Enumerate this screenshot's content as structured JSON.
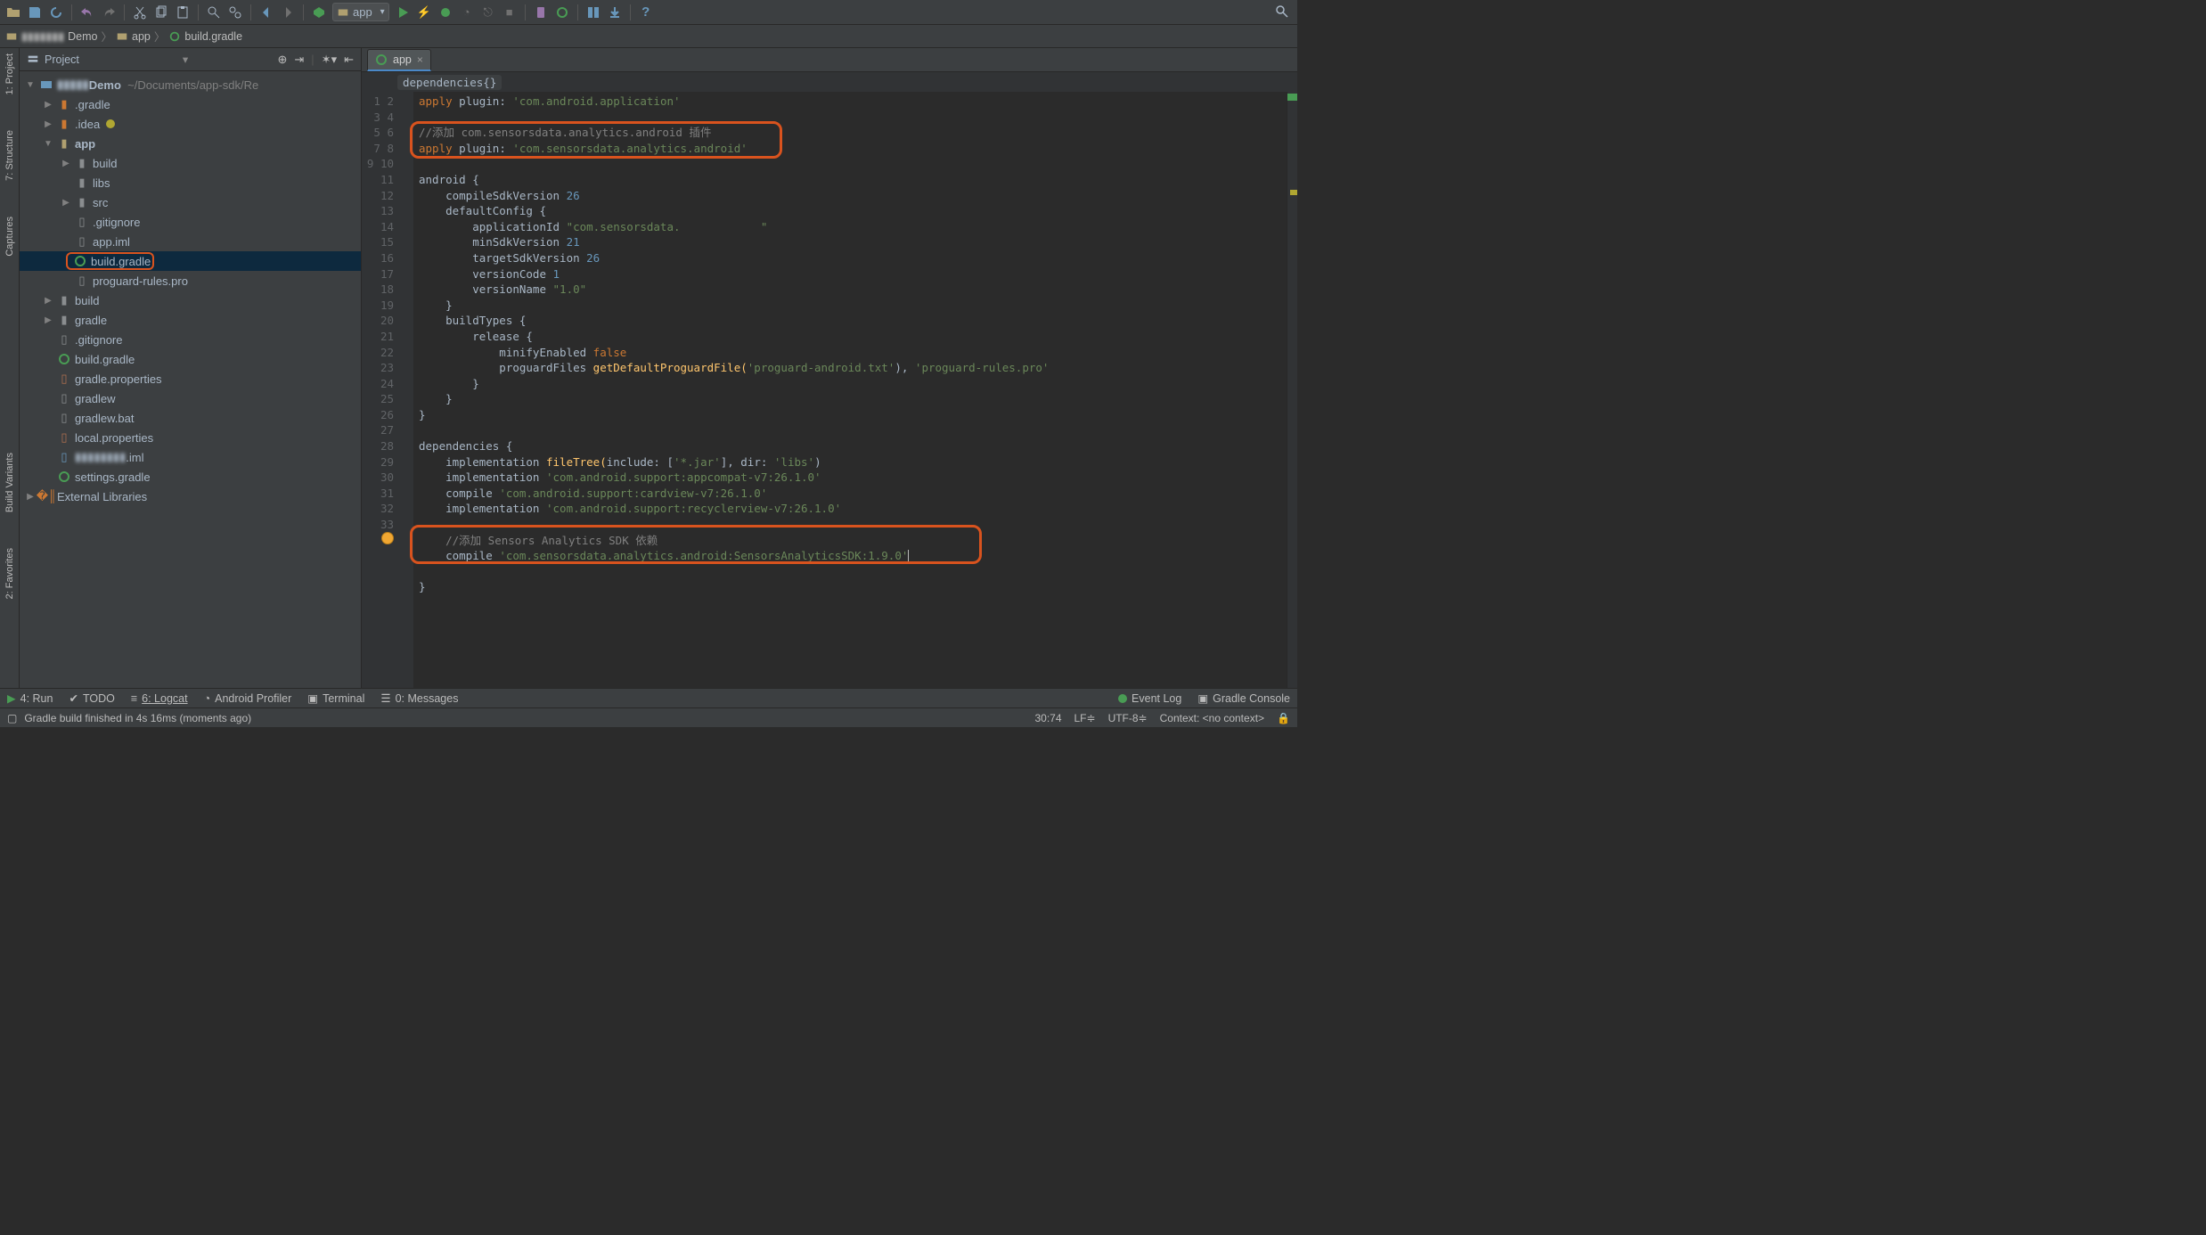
{
  "toolbar": {
    "run_config": "app"
  },
  "breadcrumb": {
    "c1": "Demo",
    "c2": "app",
    "c3": "build.gradle"
  },
  "side": {
    "project": "1: Project",
    "structure": "7: Structure",
    "captures": "Captures",
    "buildvariants": "Build Variants",
    "favorites": "2: Favorites"
  },
  "panel": {
    "title": "Project"
  },
  "tree": {
    "root": "Demo",
    "root_path": "~/Documents/app-sdk/Re",
    "gradle_dir": ".gradle",
    "idea_dir": ".idea",
    "app": "app",
    "build": "build",
    "libs": "libs",
    "src": "src",
    "gitignore": ".gitignore",
    "appiml": "app.iml",
    "buildgradle": "build.gradle",
    "proguard": "proguard-rules.pro",
    "build2": "build",
    "gradle2": "gradle",
    "gitignore2": ".gitignore",
    "buildgradle2": "build.gradle",
    "gradleprops": "gradle.properties",
    "gradlew": "gradlew",
    "gradlewbat": "gradlew.bat",
    "localprops": "local.properties",
    "iml": ".iml",
    "settingsgradle": "settings.gradle",
    "extlib": "External Libraries"
  },
  "editor": {
    "tab": "app",
    "bc": "dependencies{}"
  },
  "code": {
    "l1a": "apply",
    "l1b": " plugin: ",
    "l1c": "'com.android.application'",
    "l3": "//添加 com.sensorsdata.analytics.android 插件",
    "l4a": "apply",
    "l4b": " plugin: ",
    "l4c": "'com.sensorsdata.analytics.android'",
    "l6a": "android ",
    "l6b": "{",
    "l7a": "    compileSdkVersion ",
    "l7b": "26",
    "l8": "    defaultConfig {",
    "l9a": "        applicationId ",
    "l9b": "\"com.sensorsdata.            \"",
    "l10a": "        minSdkVersion ",
    "l10b": "21",
    "l11a": "        targetSdkVersion ",
    "l11b": "26",
    "l12a": "        versionCode ",
    "l12b": "1",
    "l13a": "        versionName ",
    "l13b": "\"1.0\"",
    "l14": "    }",
    "l15": "    buildTypes {",
    "l16": "        release {",
    "l17a": "            minifyEnabled ",
    "l17b": "false",
    "l18a": "            proguardFiles ",
    "l18b": "getDefaultProguardFile(",
    "l18c": "'proguard-android.txt'",
    "l18d": "), ",
    "l18e": "'proguard-rules.pro'",
    "l19": "        }",
    "l20": "    }",
    "l21": "}",
    "l23": "dependencies {",
    "l24a": "    implementation ",
    "l24b": "fileTree(",
    "l24c": "include: [",
    "l24d": "'*.jar'",
    "l24e": "], dir: ",
    "l24f": "'libs'",
    "l24g": ")",
    "l25a": "    implementation ",
    "l25b": "'com.android.support:appcompat-v7:26.1.0'",
    "l26a": "    compile ",
    "l26b": "'com.android.support:cardview-v7:26.1.0'",
    "l27a": "    implementation ",
    "l27b": "'com.android.support:recyclerview-v7:26.1.0'",
    "l29": "    //添加 Sensors Analytics SDK 依赖",
    "l30a": "    compile ",
    "l30b": "'com.sensorsdata.analytics.android:SensorsAnalyticsSDK:1.9.0'",
    "l32": "}"
  },
  "bottombar": {
    "run": "4: Run",
    "todo": "TODO",
    "logcat": "6: Logcat",
    "profiler": "Android Profiler",
    "terminal": "Terminal",
    "messages": "0: Messages",
    "eventlog": "Event Log",
    "gradleconsole": "Gradle Console"
  },
  "status": {
    "msg": "Gradle build finished in 4s 16ms (moments ago)",
    "pos": "30:74",
    "lf": "LF≑",
    "enc": "UTF-8≑",
    "ctx": "Context: <no context>"
  }
}
